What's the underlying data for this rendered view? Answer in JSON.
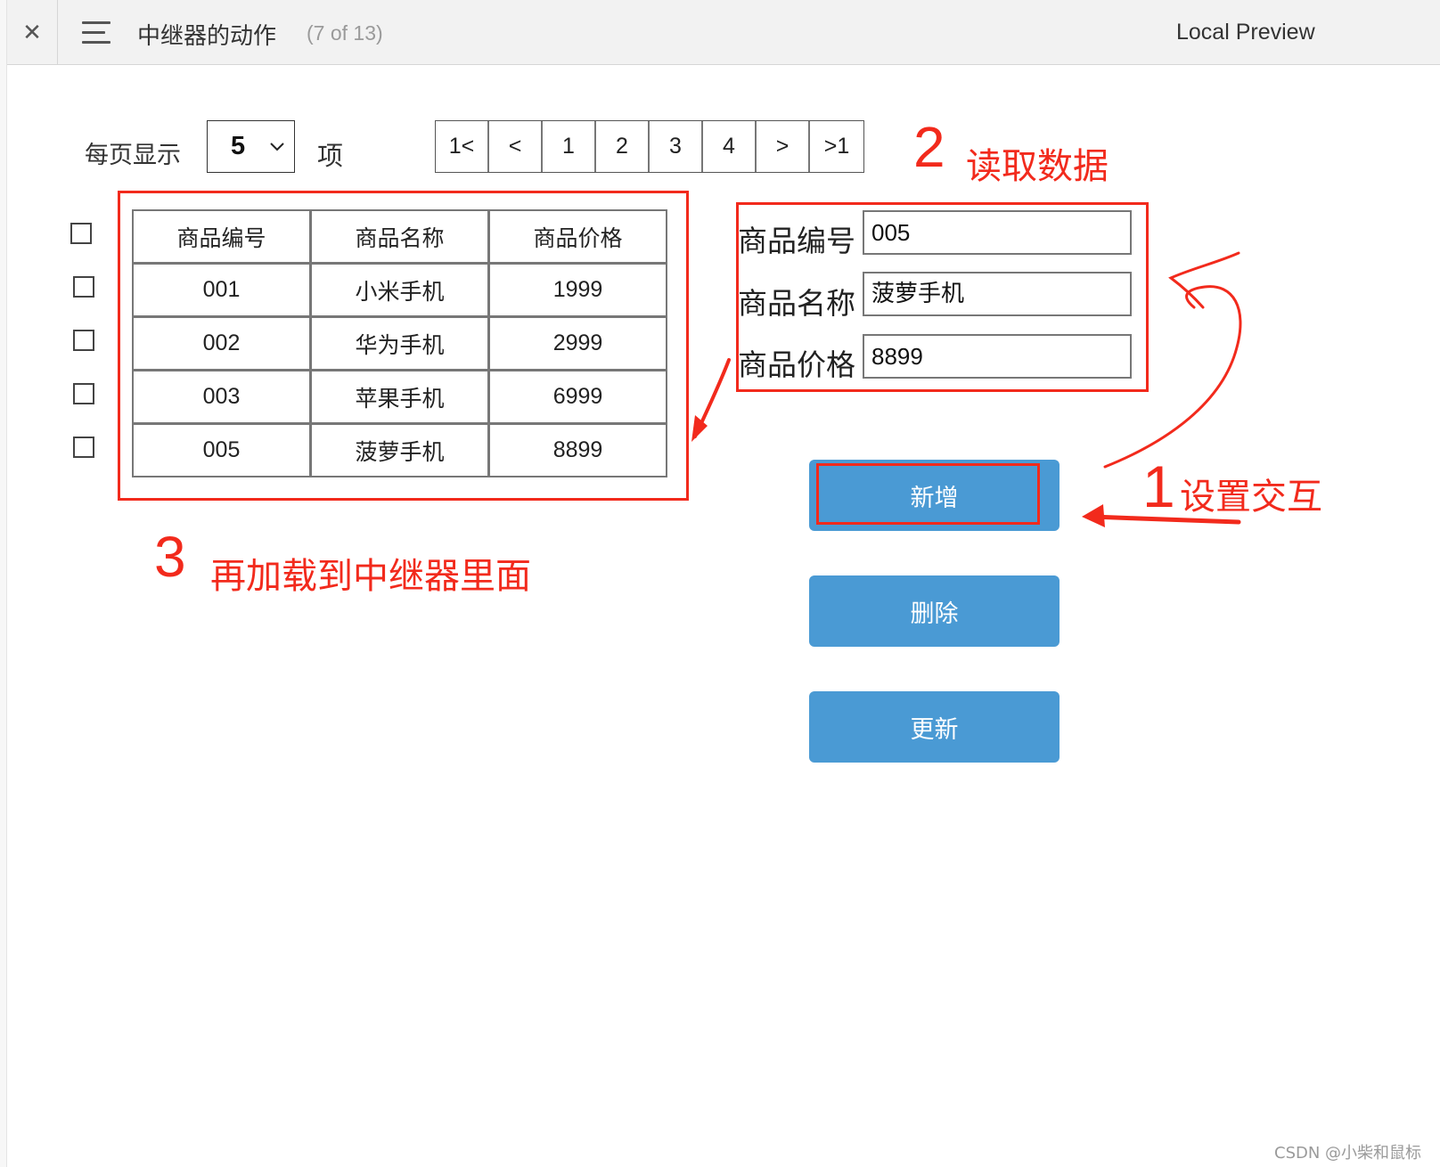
{
  "topbar": {
    "close_icon": "close-icon",
    "menu_icon": "hamburger-menu-icon",
    "title": "中继器的动作",
    "page_count": "(7 of 13)",
    "preview_label": "Local Preview"
  },
  "pagination": {
    "per_page_label": "每页显示",
    "per_page_value": "5",
    "unit_label": "项",
    "pages": [
      "1<",
      "<",
      "1",
      "2",
      "3",
      "4",
      ">",
      ">1"
    ]
  },
  "table": {
    "headers": [
      "商品编号",
      "商品名称",
      "商品价格"
    ],
    "rows": [
      [
        "001",
        "小米手机",
        "1999"
      ],
      [
        "002",
        "华为手机",
        "2999"
      ],
      [
        "003",
        "苹果手机",
        "6999"
      ],
      [
        "005",
        "菠萝手机",
        "8899"
      ]
    ]
  },
  "form": {
    "id_label": "商品编号",
    "id_value": "005",
    "name_label": "商品名称",
    "name_value": "菠萝手机",
    "price_label": "商品价格",
    "price_value": "8899"
  },
  "buttons": {
    "add": "新增",
    "delete": "删除",
    "update": "更新"
  },
  "annotations": {
    "step1_num": "1",
    "step1_text": "设置交互",
    "step2_num": "2",
    "step2_text": "读取数据",
    "step3_num": "3",
    "step3_text": "再加载到中继器里面",
    "color": "#f22a1c"
  },
  "colors": {
    "button": "#4a9ad4",
    "topbar": "#f2f2f2"
  },
  "watermark": "CSDN @小柴和鼠标"
}
